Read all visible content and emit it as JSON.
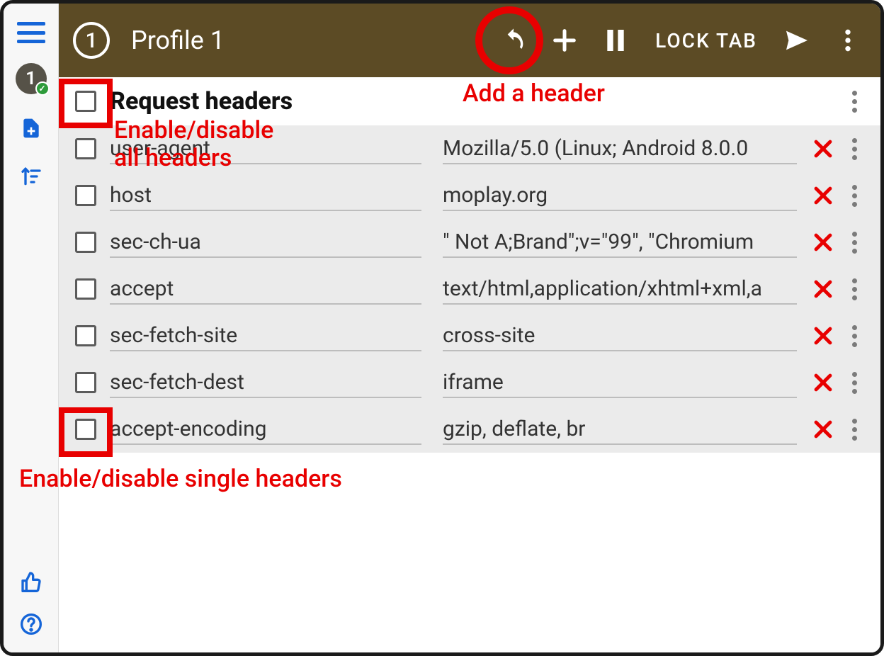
{
  "rail": {
    "profile_number": "1"
  },
  "topbar": {
    "profile_number": "1",
    "title": "Profile 1",
    "lock_label": "LOCK TAB"
  },
  "section": {
    "title": "Request headers"
  },
  "headers": [
    {
      "name": "user-agent",
      "value": "Mozilla/5.0 (Linux; Android 8.0.0"
    },
    {
      "name": "host",
      "value": "moplay.org"
    },
    {
      "name": "sec-ch-ua",
      "value": "\" Not A;Brand\";v=\"99\", \"Chromium"
    },
    {
      "name": "accept",
      "value": "text/html,application/xhtml+xml,a"
    },
    {
      "name": "sec-fetch-site",
      "value": "cross-site"
    },
    {
      "name": "sec-fetch-dest",
      "value": "iframe"
    },
    {
      "name": "accept-encoding",
      "value": "gzip, deflate, br"
    }
  ],
  "annotations": {
    "add_header": "Add a header",
    "toggle_all": "Enable/disable\nall headers",
    "toggle_single": "Enable/disable single headers"
  }
}
